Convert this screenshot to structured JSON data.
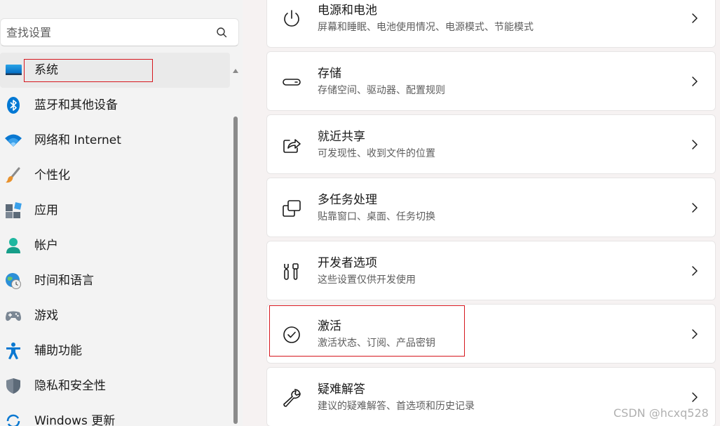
{
  "search": {
    "placeholder": "查找设置",
    "icon": "search-icon"
  },
  "sidebar": {
    "items": [
      {
        "label": "系统",
        "icon": "system-display-icon",
        "selected": true
      },
      {
        "label": "蓝牙和其他设备",
        "icon": "bluetooth-icon"
      },
      {
        "label": "网络和 Internet",
        "icon": "wifi-icon"
      },
      {
        "label": "个性化",
        "icon": "paintbrush-icon"
      },
      {
        "label": "应用",
        "icon": "apps-icon"
      },
      {
        "label": "帐户",
        "icon": "account-icon"
      },
      {
        "label": "时间和语言",
        "icon": "globe-clock-icon"
      },
      {
        "label": "游戏",
        "icon": "gamepad-icon"
      },
      {
        "label": "辅助功能",
        "icon": "accessibility-icon"
      },
      {
        "label": "隐私和安全性",
        "icon": "shield-icon"
      },
      {
        "label": "Windows 更新",
        "icon": "windows-update-icon"
      }
    ]
  },
  "main": {
    "cards": [
      {
        "title": "电源和电池",
        "description": "屏幕和睡眠、电池使用情况、电源模式、节能模式",
        "icon": "power-icon"
      },
      {
        "title": "存储",
        "description": "存储空间、驱动器、配置规则",
        "icon": "storage-drive-icon"
      },
      {
        "title": "就近共享",
        "description": "可发现性、收到文件的位置",
        "icon": "share-icon"
      },
      {
        "title": "多任务处理",
        "description": "贴靠窗口、桌面、任务切换",
        "icon": "multitasking-icon"
      },
      {
        "title": "开发者选项",
        "description": "这些设置仅供开发使用",
        "icon": "developer-tools-icon"
      },
      {
        "title": "激活",
        "description": "激活状态、订阅、产品密钥",
        "icon": "activation-check-icon"
      },
      {
        "title": "疑难解答",
        "description": "建议的疑难解答、首选项和历史记录",
        "icon": "wrench-icon"
      }
    ]
  },
  "watermark": "CSDN @hcxq528",
  "colors": {
    "highlight_box": "#d6171e",
    "accent_blue": "#0067c0",
    "page_background": "#f3f3f3",
    "card_background": "#ffffff"
  }
}
